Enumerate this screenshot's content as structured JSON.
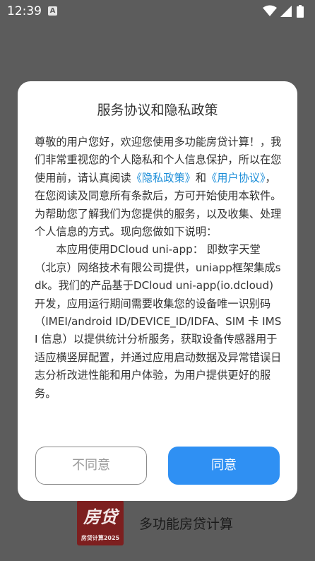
{
  "status_bar": {
    "time": "12:39",
    "notification_icon": "A",
    "icons": [
      "wifi-icon",
      "signal-icon",
      "battery-icon"
    ]
  },
  "background_app": {
    "logo_text": "房贷",
    "logo_subtext": "房贷计算2025",
    "app_name": "多功能房贷计算"
  },
  "dialog": {
    "title": "服务协议和隐私政策",
    "p1_part1": "尊敬的用户您好，欢迎您使用多功能房贷计算！，我们非常重视您的个人隐私和个人信息保护，所以在您使用前，请认真阅读",
    "privacy_link": "《隐私政策》",
    "p1_and": "和",
    "user_agreement_link": "《用户协议》",
    "p1_part2": "，在您阅读及同意所有条款后，方可开始使用本软件。",
    "p2": "为帮助您了解我们为您提供的服务，以及收集、处理个人信息的方式。现向您做如下说明：",
    "p3": "本应用使用DCloud uni-app： 即数字天堂（北京）网络技术有限公司提供，uniapp框架集成sdk。我们的产品基于DCloud uni-app(io.dcloud)开发，应用运行期间需要收集您的设备唯一识别码（IMEI/android ID/DEVICE_ID/IDFA、SIM 卡 IMSI 信息）以提供统计分析服务，获取设备传感器用于适应横竖屏配置，并通过应用启动数据及异常错误日志分析改进性能和用户体验，为用户提供更好的服务。",
    "disagree_label": "不同意",
    "agree_label": "同意"
  },
  "colors": {
    "accent": "#2f90f3",
    "link": "#1a8dd8",
    "overlay": "#5c5c5c"
  }
}
